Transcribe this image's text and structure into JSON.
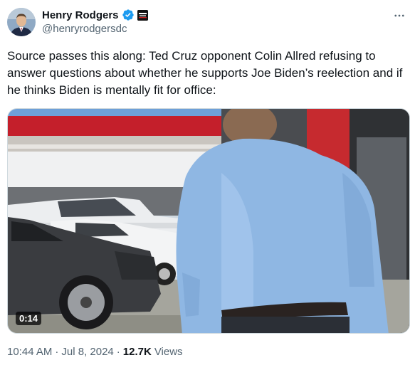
{
  "author": {
    "display_name": "Henry Rodgers",
    "handle": "@henryrodgersdc",
    "affiliate_text": "DAILY CALLER"
  },
  "tweet": {
    "text": "Source passes this along: Ted Cruz opponent Colin Allred refusing to answer questions about whether he supports Joe Biden’s reelection and if he thinks Biden is mentally fit for office:"
  },
  "media": {
    "duration": "0:14"
  },
  "meta": {
    "time": "10:44 AM",
    "separator": "·",
    "date": "Jul 8, 2024",
    "views_count": "12.7K",
    "views_label": "Views"
  },
  "colors": {
    "verified_blue": "#1d9bf0",
    "text_primary": "#0f1419",
    "text_secondary": "#536471"
  },
  "icons": {
    "verified": "verified-badge-icon",
    "more": "more-horizontal-icon"
  }
}
